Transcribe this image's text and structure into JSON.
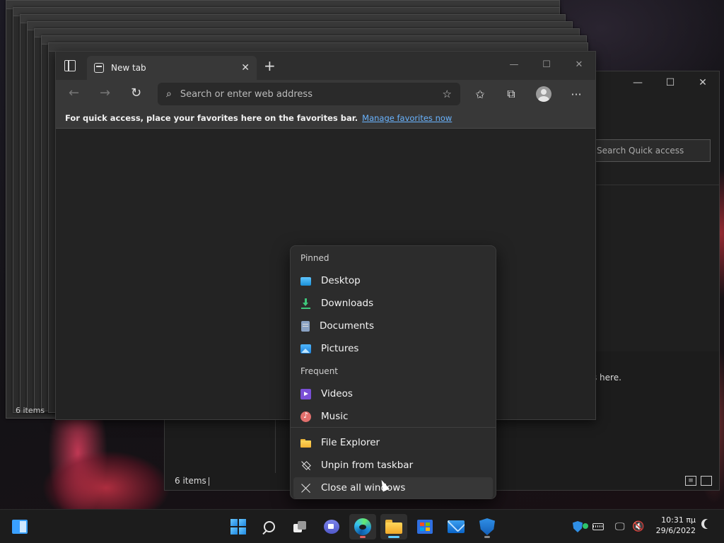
{
  "background_windows": {
    "status_items": "6 items"
  },
  "explorer": {
    "minimize": "—",
    "maximize": "☐",
    "close": "✕",
    "search_placeholder": "Search Quick access",
    "empty_message": "nes here.",
    "status_items": "6 items"
  },
  "edge": {
    "tab_title": "New tab",
    "tab_close": "✕",
    "new_tab": "+",
    "window_controls": {
      "minimize": "—",
      "maximize": "☐",
      "close": "✕"
    },
    "nav": {
      "back": "←",
      "forward": "→",
      "refresh": "↻"
    },
    "address_placeholder": "Search or enter web address",
    "favbar_message": "For quick access, place your favorites here on the favorites bar.",
    "favbar_link": "Manage favorites now",
    "toolbar_more": "···"
  },
  "jumplist": {
    "pinned_header": "Pinned",
    "frequent_header": "Frequent",
    "pinned": [
      {
        "label": "Desktop",
        "icon": "desktop-icon"
      },
      {
        "label": "Downloads",
        "icon": "downloads-icon"
      },
      {
        "label": "Documents",
        "icon": "documents-icon"
      },
      {
        "label": "Pictures",
        "icon": "pictures-icon"
      }
    ],
    "frequent": [
      {
        "label": "Videos",
        "icon": "videos-icon"
      },
      {
        "label": "Music",
        "icon": "music-icon"
      }
    ],
    "tasks": {
      "app": "File Explorer",
      "unpin": "Unpin from taskbar",
      "close_all": "Close all windows"
    }
  },
  "taskbar": {
    "apps": [
      "start",
      "search",
      "task-view",
      "chat",
      "edge",
      "file-explorer",
      "store",
      "mail",
      "security"
    ],
    "clock_time": "10:31 πμ",
    "clock_date": "29/6/2022"
  },
  "colors": {
    "accent": "#60cdff",
    "link": "#6ab4ff",
    "jumplist_bg": "#2c2c2c",
    "taskbar_bg": "#1c1c1c"
  }
}
